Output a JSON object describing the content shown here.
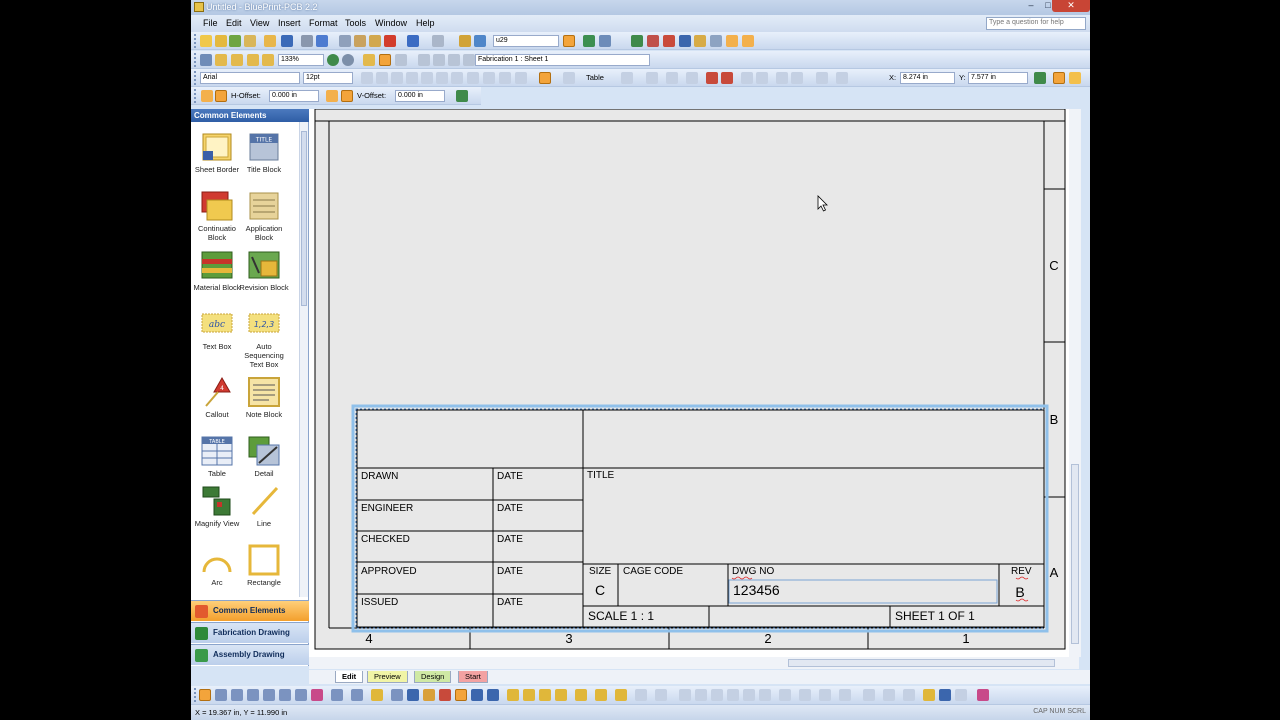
{
  "window": {
    "title": "Untitled - BluePrint-PCB 2.2",
    "min": "–",
    "max": "□",
    "close": "✕"
  },
  "menu": {
    "items": [
      "File",
      "Edit",
      "View",
      "Insert",
      "Format",
      "Tools",
      "Window",
      "Help"
    ],
    "help_placeholder": "Type a question for help"
  },
  "toolbar": {
    "font_name": "Arial",
    "font_size": "12pt",
    "layer_value": "u29",
    "zoom": "133%",
    "sheet_select": "Fabrication 1 : Sheet 1",
    "table_label": "Table",
    "x_label": "X:",
    "x_value": "8.274 in",
    "y_label": "Y:",
    "y_value": "7.577 in",
    "hoffset_label": "H-Offset:",
    "hoffset_value": "0.000 in",
    "voffset_label": "V-Offset:",
    "voffset_value": "0.000 in"
  },
  "left_panel": {
    "header": "Common Elements",
    "tools": [
      {
        "label": "Sheet Border",
        "icon": "sheet-border-icon"
      },
      {
        "label": "Title Block",
        "icon": "title-block-icon"
      },
      {
        "label": "Continuatio Block",
        "icon": "continuation-block-icon"
      },
      {
        "label": "Application Block",
        "icon": "application-block-icon"
      },
      {
        "label": "Material Block",
        "icon": "material-block-icon"
      },
      {
        "label": "Revision Block",
        "icon": "revision-block-icon"
      },
      {
        "label": "Text Box",
        "icon": "text-box-icon"
      },
      {
        "label": "Auto Sequencing Text Box",
        "icon": "auto-sequencing-icon"
      },
      {
        "label": "Callout",
        "icon": "callout-icon"
      },
      {
        "label": "Note Block",
        "icon": "note-block-icon"
      },
      {
        "label": "Table",
        "icon": "table-icon"
      },
      {
        "label": "Detail",
        "icon": "detail-icon"
      },
      {
        "label": "Magnify View",
        "icon": "magnify-view-icon"
      },
      {
        "label": "Line",
        "icon": "line-icon"
      },
      {
        "label": "Arc",
        "icon": "arc-icon"
      },
      {
        "label": "Rectangle",
        "icon": "rectangle-icon"
      }
    ],
    "icon_text": {
      "title": "TITLE",
      "abc": "abc",
      "seq": "1,2,3",
      "callout": "4",
      "table": "TABLE"
    },
    "categories": [
      "Common Elements",
      "Fabrication Drawing",
      "Assembly Drawing"
    ]
  },
  "drawing": {
    "zone_labels_right": [
      "C",
      "B",
      "A"
    ],
    "zone_numbers_bottom": [
      "4",
      "3",
      "2",
      "1"
    ],
    "title_block": {
      "drawn": "DRAWN",
      "engineer": "ENGINEER",
      "checked": "CHECKED",
      "approved": "APPROVED",
      "issued": "ISSUED",
      "date": "DATE",
      "title": "TITLE",
      "size_label": "SIZE",
      "size_value": "C",
      "cage_code": "CAGE CODE",
      "dwg_no_label": "DWG NO",
      "dwg_no_value": "123456",
      "rev_label": "REV",
      "rev_value": "B",
      "scale": "SCALE 1 : 1",
      "sheet": "SHEET 1 OF 1"
    }
  },
  "tabs": [
    "Edit",
    "Preview",
    "Design",
    "Start"
  ],
  "status": {
    "coords": "X = 19.367 in, Y = 11.990 in",
    "indicators": "CAP  NUM  SCRL"
  }
}
